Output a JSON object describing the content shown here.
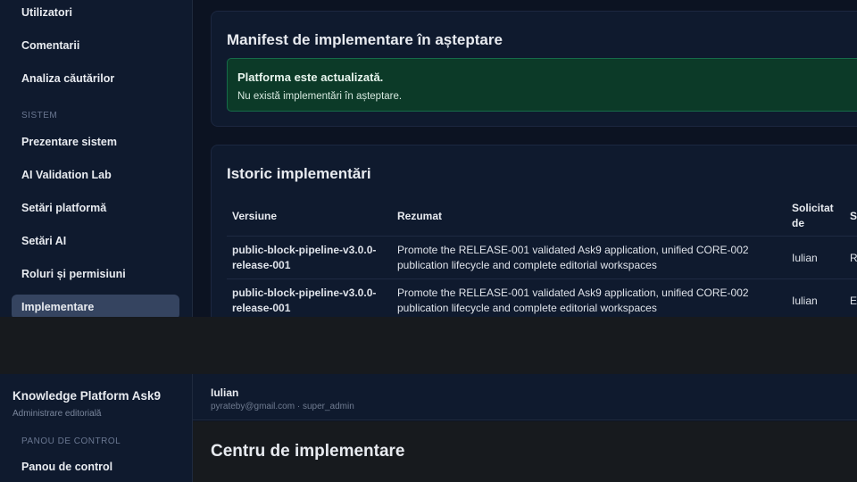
{
  "sidebar": {
    "items": [
      {
        "label": "Utilizatori"
      },
      {
        "label": "Comentarii"
      },
      {
        "label": "Analiza căutărilor"
      },
      {
        "label": "Prezentare sistem"
      },
      {
        "label": "AI Validation Lab"
      },
      {
        "label": "Setări platformă"
      },
      {
        "label": "Setări AI"
      },
      {
        "label": "Roluri și permisiuni"
      },
      {
        "label": "Implementare"
      }
    ],
    "section_system": "SISTEM",
    "brand_title": "Knowledge Platform Ask9",
    "brand_subtitle": "Administrare editorială",
    "section_control": "PANOU DE CONTROL",
    "control_item": "Panou de control"
  },
  "pending": {
    "title": "Manifest de implementare în așteptare",
    "alert_title": "Platforma este actualizată.",
    "alert_text": "Nu există implementări în așteptare."
  },
  "history": {
    "title": "Istoric implementări",
    "columns": [
      "Versiune",
      "Rezumat",
      "Solicitat de",
      "St"
    ],
    "rows": [
      {
        "version": "public-block-pipeline-v3.0.0-release-001",
        "summary": "Promote the RELEASE-001 validated Ask9 application, unified CORE-002 publication lifecycle and complete editorial workspaces",
        "requested_by": "Iulian",
        "status": "R"
      },
      {
        "version": "public-block-pipeline-v3.0.0-release-001",
        "summary": "Promote the RELEASE-001 validated Ask9 application, unified CORE-002 publication lifecycle and complete editorial workspaces",
        "requested_by": "Iulian",
        "status": "Es"
      }
    ]
  },
  "user": {
    "name": "Iulian",
    "meta": "pyrateby@gmail.com · super_admin"
  },
  "page_title": "Centru de implementare"
}
